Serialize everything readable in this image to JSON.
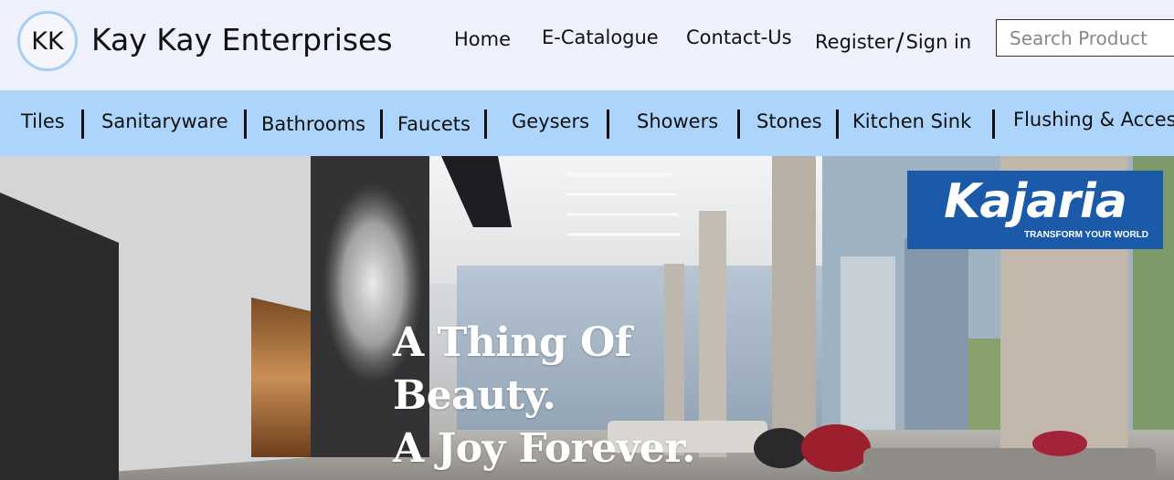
{
  "header": {
    "logo_initials": "KK",
    "brand_name": "Kay Kay Enterprises",
    "nav": {
      "home": "Home",
      "catalogue": "E-Catalogue",
      "contact": "Contact-Us",
      "register": "Register",
      "separator": "/",
      "signin": "Sign in"
    },
    "search": {
      "placeholder": "Search Product",
      "value": ""
    }
  },
  "categories": [
    "Tiles",
    "Sanitaryware",
    "Bathrooms",
    "Faucets",
    "Geysers",
    "Showers",
    "Stones",
    "Kitchen Sink",
    "Flushing & Accessories"
  ],
  "hero": {
    "tagline": [
      "A Thing Of",
      "Beauty.",
      "A Joy Forever."
    ],
    "partner_logo": {
      "name": "Kajaria",
      "slogan": "TRANSFORM YOUR WORLD"
    }
  },
  "colors": {
    "header_bg": "#eef1fb",
    "category_bar_bg": "#add5fb",
    "logo_ring": "#a8cdf3",
    "kajaria_blue": "#1a5aa9"
  }
}
